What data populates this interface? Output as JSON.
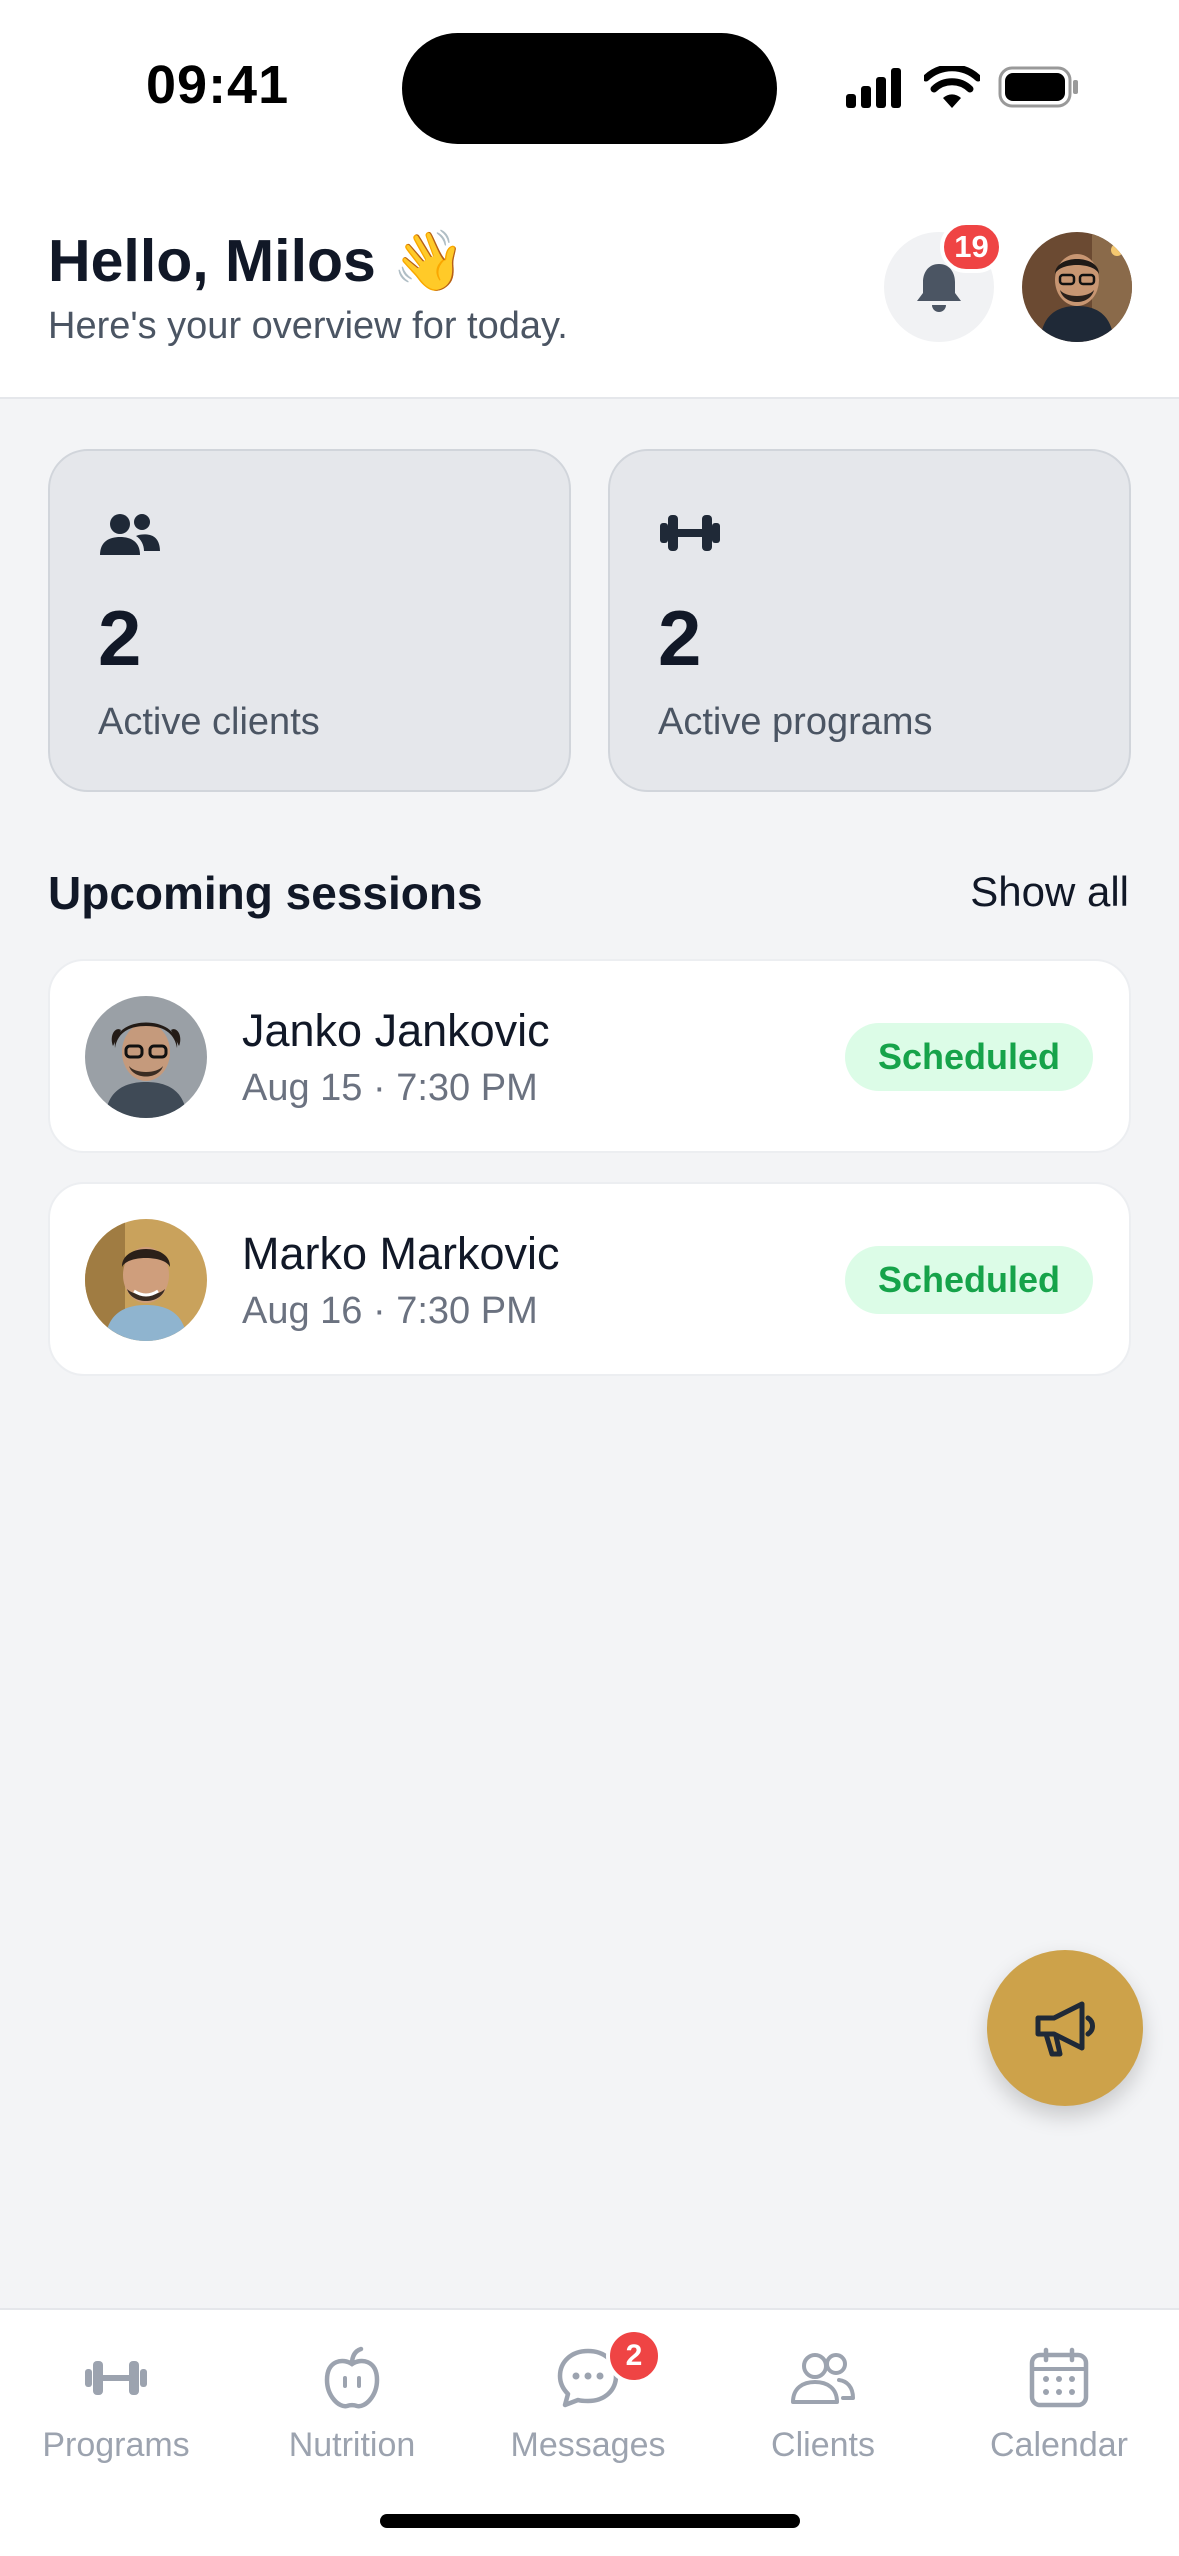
{
  "status_bar": {
    "time": "09:41"
  },
  "header": {
    "greeting": "Hello, Milos 👋",
    "subtitle": "Here's your overview for today.",
    "notification_count": "19"
  },
  "stats": [
    {
      "icon": "users-icon",
      "value": "2",
      "label": "Active clients"
    },
    {
      "icon": "dumbbell-icon",
      "value": "2",
      "label": "Active programs"
    }
  ],
  "sessions_section": {
    "title": "Upcoming sessions",
    "show_all_label": "Show all",
    "items": [
      {
        "name": "Janko Jankovic",
        "time": "Aug 15 · 7:30 PM",
        "status": "Scheduled"
      },
      {
        "name": "Marko Markovic",
        "time": "Aug 16 · 7:30 PM",
        "status": "Scheduled"
      }
    ]
  },
  "fab": {
    "icon": "megaphone-icon"
  },
  "tab_bar": {
    "tabs": [
      {
        "label": "Programs",
        "icon": "dumbbell-icon"
      },
      {
        "label": "Nutrition",
        "icon": "apple-icon"
      },
      {
        "label": "Messages",
        "icon": "chat-icon",
        "badge": "2"
      },
      {
        "label": "Clients",
        "icon": "users-icon"
      },
      {
        "label": "Calendar",
        "icon": "calendar-icon"
      }
    ]
  },
  "colors": {
    "accent_gold": "#cda24a",
    "badge_red": "#ef4444",
    "status_green": "#16a34a",
    "status_green_bg": "#dcfce7"
  }
}
